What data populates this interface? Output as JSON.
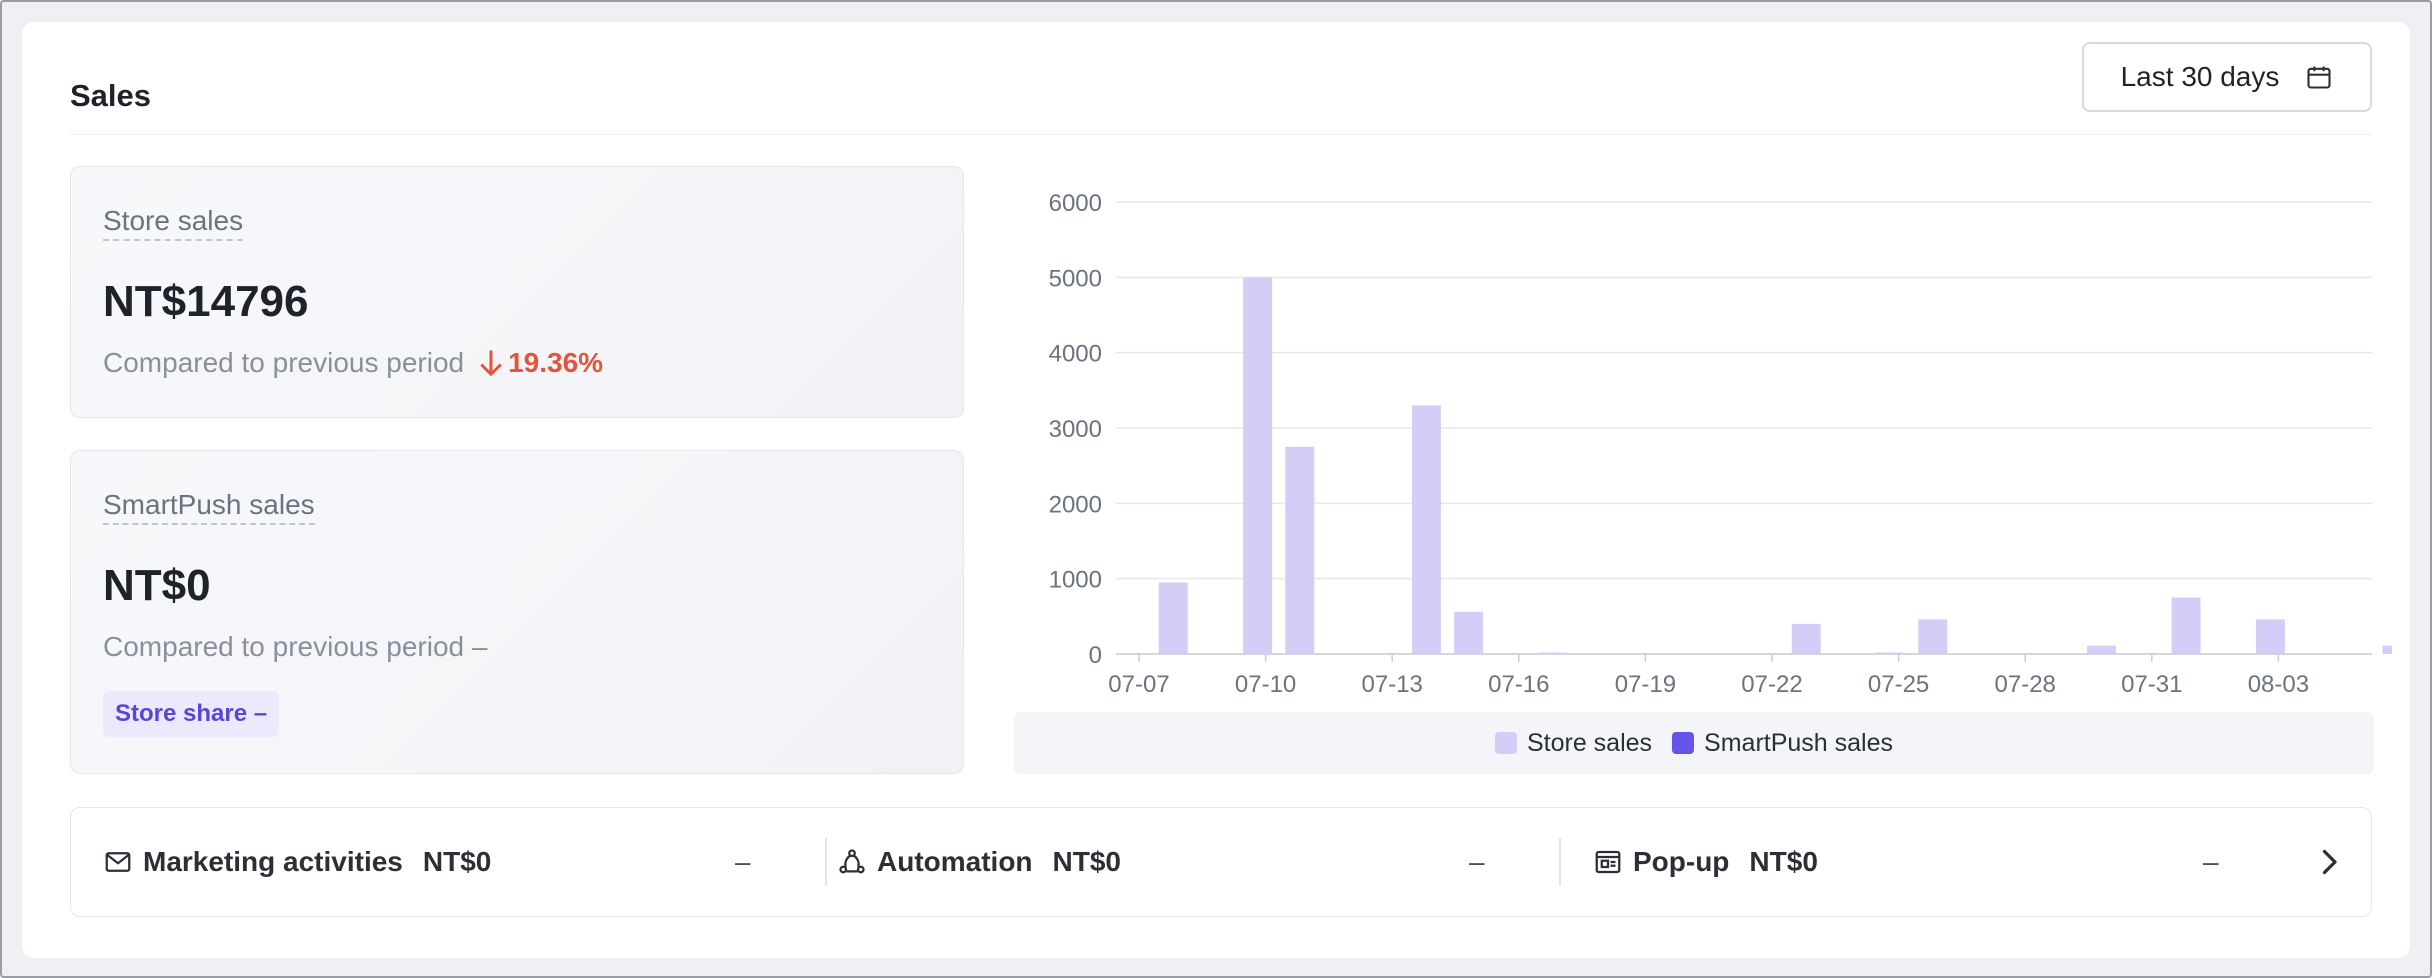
{
  "header": {
    "title": "Sales",
    "date_range": "Last 30 days"
  },
  "store_sales": {
    "label": "Store sales",
    "value": "NT$14796",
    "compare_label": "Compared to previous period",
    "change": "19.36%"
  },
  "smartpush_sales": {
    "label": "SmartPush sales",
    "value": "NT$0",
    "compare_label": "Compared to previous period –",
    "share_badge": "Store share –"
  },
  "chart_data": {
    "type": "bar",
    "y_ticks": [
      "0",
      "1000",
      "2000",
      "3000",
      "4000",
      "5000",
      "6000"
    ],
    "ylim": [
      0,
      6000
    ],
    "x_tick_labels": [
      "07-07",
      "07-10",
      "07-13",
      "07-16",
      "07-19",
      "07-22",
      "07-25",
      "07-28",
      "07-31",
      "08-03"
    ],
    "categories": [
      "07-07",
      "07-08",
      "07-09",
      "07-10",
      "07-11",
      "07-12",
      "07-13",
      "07-14",
      "07-15",
      "07-16",
      "07-17",
      "07-18",
      "07-19",
      "07-20",
      "07-21",
      "07-22",
      "07-23",
      "07-24",
      "07-25",
      "07-26",
      "07-27",
      "07-28",
      "07-29",
      "07-30",
      "07-31",
      "08-01",
      "08-02",
      "08-03",
      "08-04",
      "08-05"
    ],
    "series": [
      {
        "name": "Store sales",
        "color": "#d4cdf8",
        "values": [
          0,
          950,
          0,
          5000,
          2750,
          0,
          0,
          3300,
          560,
          0,
          20,
          0,
          0,
          0,
          0,
          0,
          400,
          0,
          20,
          460,
          0,
          0,
          0,
          110,
          0,
          750,
          0,
          460,
          0,
          0,
          110
        ]
      },
      {
        "name": "SmartPush sales",
        "color": "#6554e8",
        "values": [
          0,
          0,
          0,
          0,
          0,
          0,
          0,
          0,
          0,
          0,
          0,
          0,
          0,
          0,
          0,
          0,
          0,
          0,
          0,
          0,
          0,
          0,
          0,
          0,
          0,
          0,
          0,
          0,
          0,
          0,
          0
        ]
      }
    ],
    "grid": true,
    "legend": "bottom"
  },
  "channels": [
    {
      "name": "Marketing activities",
      "amount": "NT$0",
      "change": "–",
      "icon": "mail-icon"
    },
    {
      "name": "Automation",
      "amount": "NT$0",
      "change": "–",
      "icon": "automation-icon"
    },
    {
      "name": "Pop-up",
      "amount": "NT$0",
      "change": "–",
      "icon": "popup-icon"
    }
  ]
}
